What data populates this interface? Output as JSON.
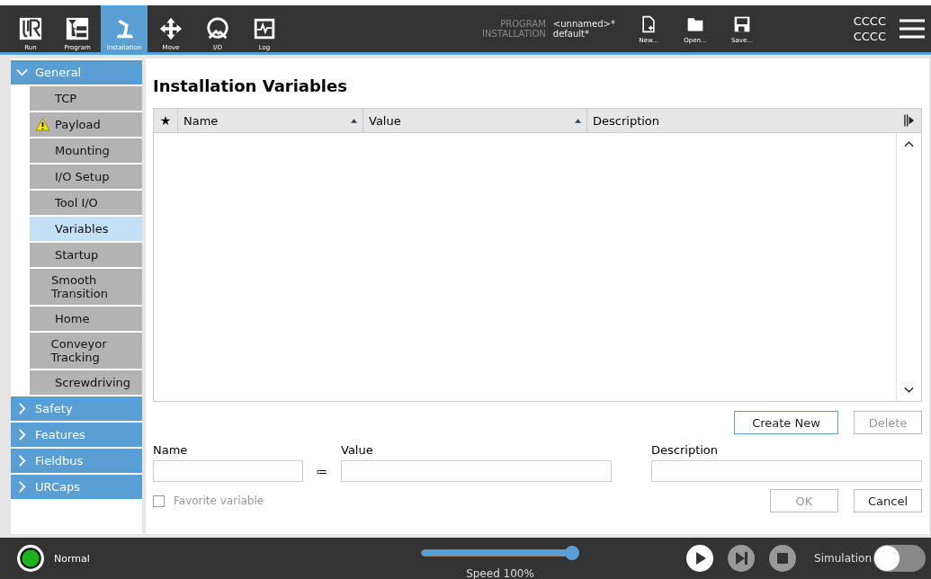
{
  "top_bar": {
    "tabs": [
      {
        "kind": "run",
        "label": "Run",
        "selected": false
      },
      {
        "kind": "program",
        "label": "Program",
        "selected": false
      },
      {
        "kind": "installation",
        "label": "Installation",
        "selected": true
      },
      {
        "kind": "move",
        "label": "Move",
        "selected": false
      },
      {
        "kind": "io",
        "label": "I/O",
        "selected": false
      },
      {
        "kind": "log",
        "label": "Log",
        "selected": false
      }
    ],
    "file_info": [
      {
        "label": "PROGRAM",
        "value": "<unnamed>*"
      },
      {
        "label": "INSTALLATION",
        "value": "default*"
      }
    ],
    "file_buttons": [
      {
        "kind": "new",
        "label": "New..."
      },
      {
        "kind": "open",
        "label": "Open..."
      },
      {
        "kind": "save",
        "label": "Save..."
      }
    ],
    "user_lines": [
      "CCCC",
      "CCCC"
    ]
  },
  "sidebar": [
    {
      "label": "General",
      "expanded": true,
      "children": [
        {
          "label": "TCP",
          "selected": false,
          "warning": false
        },
        {
          "label": "Payload",
          "selected": false,
          "warning": true
        },
        {
          "label": "Mounting",
          "selected": false,
          "warning": false
        },
        {
          "label": "I/O Setup",
          "selected": false,
          "warning": false
        },
        {
          "label": "Tool I/O",
          "selected": false,
          "warning": false
        },
        {
          "label": "Variables",
          "selected": true,
          "warning": false
        },
        {
          "label": "Startup",
          "selected": false,
          "warning": false
        },
        {
          "label": "Smooth Transition",
          "selected": false,
          "warning": false
        },
        {
          "label": "Home",
          "selected": false,
          "warning": false
        },
        {
          "label": "Conveyor Tracking",
          "selected": false,
          "warning": false
        },
        {
          "label": "Screwdriving",
          "selected": false,
          "warning": false
        }
      ]
    },
    {
      "label": "Safety",
      "expanded": false
    },
    {
      "label": "Features",
      "expanded": false
    },
    {
      "label": "Fieldbus",
      "expanded": false
    },
    {
      "label": "URCaps",
      "expanded": false
    }
  ],
  "content": {
    "title": "Installation Variables",
    "table": {
      "favorite_column": "★",
      "columns": [
        {
          "label": "Name",
          "sorted": true
        },
        {
          "label": "Value",
          "sorted": true
        },
        {
          "label": "Description",
          "sorted": false
        }
      ]
    },
    "create_button": {
      "label": "Create New",
      "disabled": false
    },
    "delete_button": {
      "label": "Delete",
      "disabled": true
    },
    "form": {
      "name_label": "Name",
      "assign": "≔",
      "value_label": "Value",
      "description_label": "Description",
      "favorite": {
        "label": "Favorite variable",
        "checked": false,
        "disabled": true
      }
    },
    "ok_button": {
      "label": "OK",
      "disabled": true
    },
    "cancel_button": {
      "label": "Cancel",
      "disabled": false
    }
  },
  "footer": {
    "status": "Normal",
    "speed": {
      "level": 1.0,
      "reading": "Speed 100%"
    },
    "controls": [
      {
        "kind": "play",
        "enabled": true
      },
      {
        "kind": "step",
        "enabled": false
      },
      {
        "kind": "stop",
        "enabled": false
      }
    ],
    "simulation": {
      "label": "Simulation",
      "on": false
    }
  }
}
